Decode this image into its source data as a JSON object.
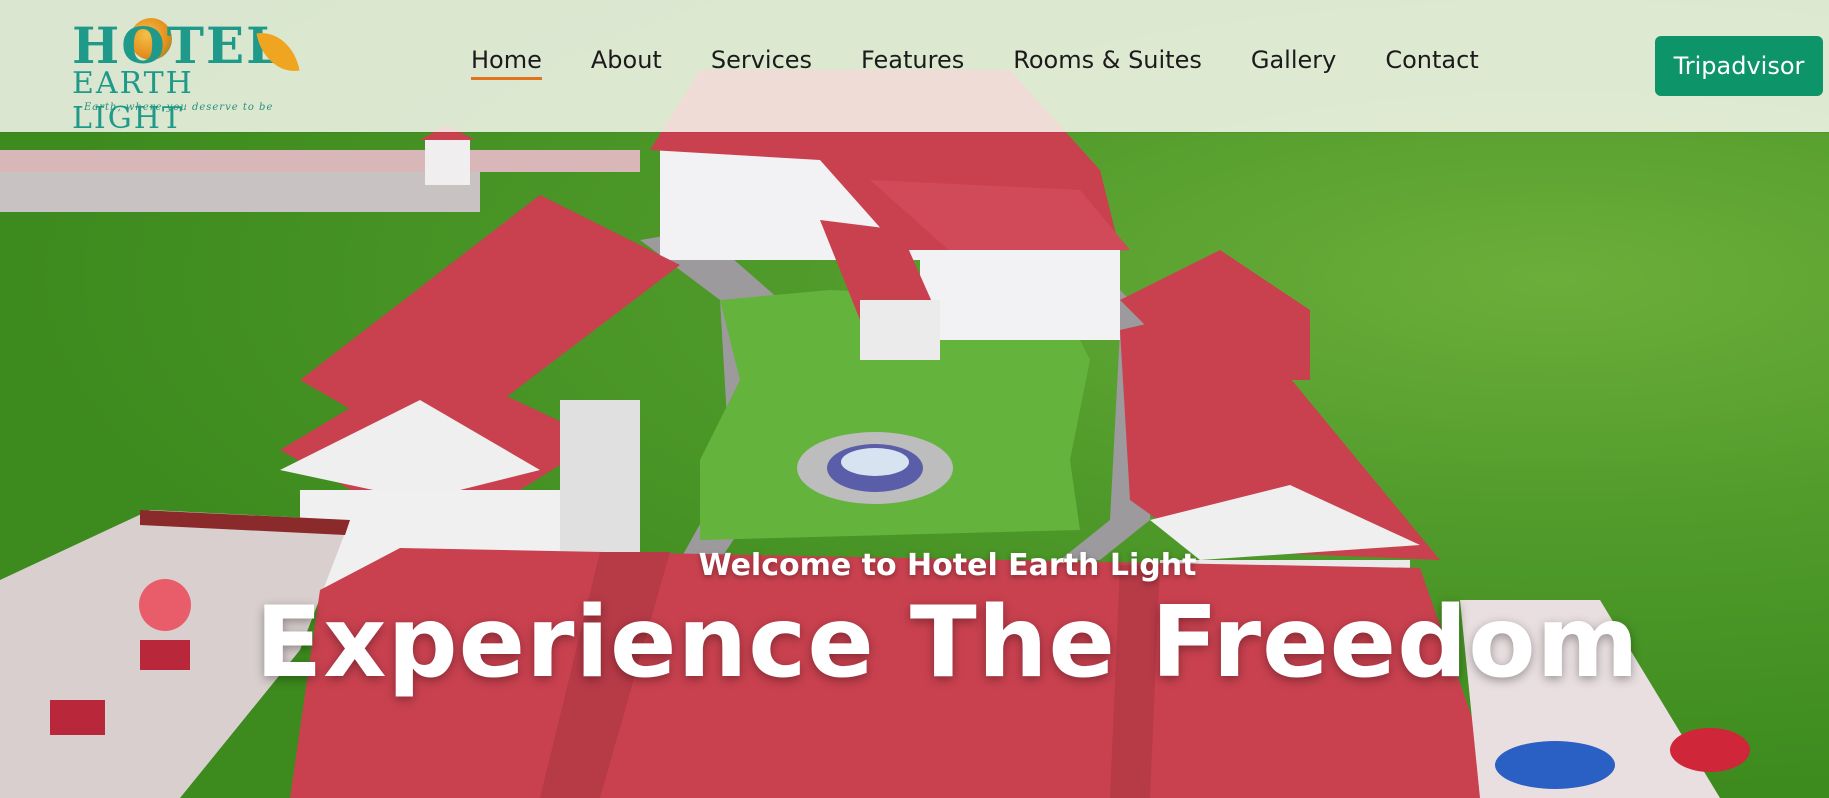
{
  "brand": {
    "logo_line1": "HOTEL",
    "logo_line2": "EARTH LIGHT",
    "logo_tagline": "Earth, where you deserve to be"
  },
  "nav": {
    "items": [
      {
        "label": "Home",
        "active": true
      },
      {
        "label": "About"
      },
      {
        "label": "Services"
      },
      {
        "label": "Features"
      },
      {
        "label": "Rooms & Suites"
      },
      {
        "label": "Gallery"
      },
      {
        "label": "Contact"
      }
    ]
  },
  "header": {
    "cta_label": "Tripadvisor"
  },
  "hero": {
    "subtitle": "Welcome to Hotel Earth Light",
    "title": "Experience The Freedom"
  },
  "colors": {
    "accent_orange": "#e0731c",
    "cta_green": "#0e9469",
    "logo_teal": "#1f9a8a",
    "roof_red": "#c9414f"
  }
}
